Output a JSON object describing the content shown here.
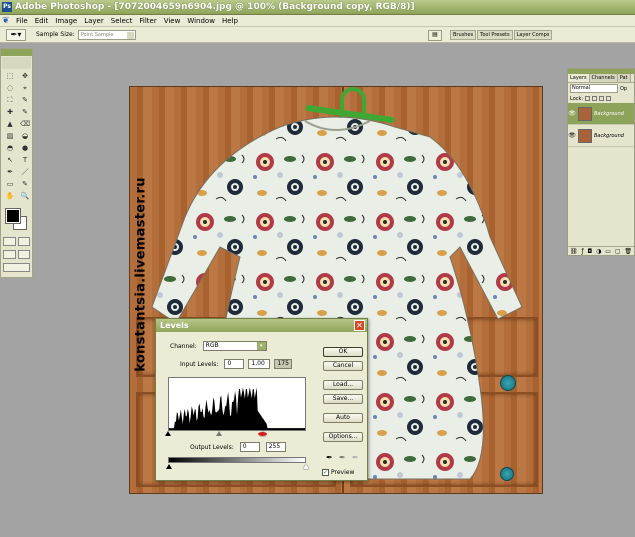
{
  "titlebar": {
    "app_name": "Adobe Photoshop - [7072004659n6904.jpg @ 100% (Background copy, RGB/8)]"
  },
  "menubar": {
    "items": [
      "File",
      "Edit",
      "Image",
      "Layer",
      "Select",
      "Filter",
      "View",
      "Window",
      "Help"
    ]
  },
  "options": {
    "sample_size_label": "Sample Size:",
    "sample_size_value": "Point Sample"
  },
  "palette_well": {
    "tabs": [
      "Brushes",
      "Tool Presets",
      "Layer Comps"
    ]
  },
  "toolbox": {
    "tools": [
      "⬚",
      "✥",
      "◌",
      "⌖",
      "⛶",
      "✎",
      "✚",
      "✎",
      "▲",
      "⌫",
      "▨",
      "◒",
      "◓",
      "●",
      "↖",
      "T",
      "✒",
      "／",
      "▭",
      "✎",
      "✋",
      "🔍"
    ]
  },
  "watermark": {
    "text": "konstantsia.livemaster.ru"
  },
  "levels": {
    "title": "Levels",
    "channel_label": "Channel:",
    "channel_value": "RGB",
    "input_levels_label": "Input Levels:",
    "input_black": "0",
    "input_gamma": "1,00",
    "input_white": "175",
    "output_levels_label": "Output Levels:",
    "output_black": "0",
    "output_white": "255",
    "buttons": {
      "ok": "OK",
      "cancel": "Cancel",
      "load": "Load...",
      "save": "Save...",
      "auto": "Auto",
      "options": "Options..."
    },
    "preview_label": "Preview",
    "preview_checked": true
  },
  "layers_panel": {
    "tabs": [
      "Layers",
      "Channels",
      "Pat"
    ],
    "blend_mode": "Normal",
    "opacity_label": "Op",
    "lock_label": "Lock:",
    "layers": [
      {
        "name": "Background",
        "active": true
      },
      {
        "name": "Background",
        "active": false
      }
    ]
  },
  "colors": {
    "title_green": "#8ea35a",
    "panel_bg": "#ecebd6",
    "workspace": "#a3a3a3"
  }
}
